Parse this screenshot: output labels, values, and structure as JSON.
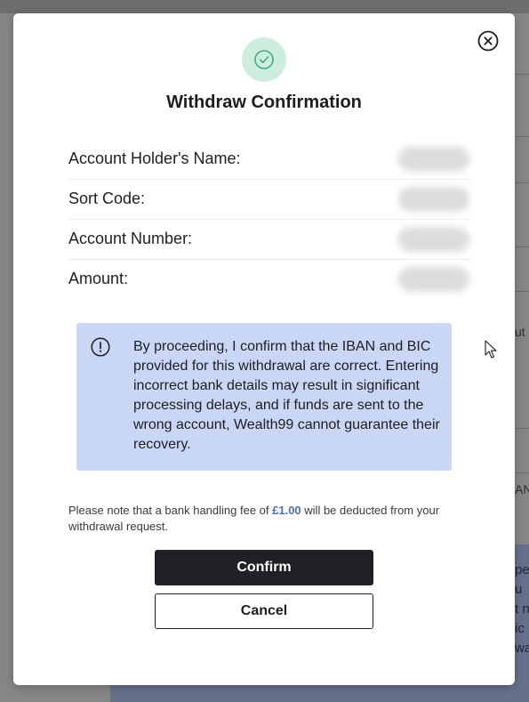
{
  "background": {
    "fragments": [
      "ut",
      "AN"
    ],
    "info_lines": [
      "pe",
      "u",
      "t n",
      "ic",
      "wa"
    ]
  },
  "modal": {
    "title": "Withdraw Confirmation",
    "close_icon": "close-circle-icon",
    "status_icon": "check-circle-icon",
    "details": [
      {
        "label": "Account Holder's Name:"
      },
      {
        "label": "Sort Code:"
      },
      {
        "label": "Account Number:"
      },
      {
        "label": "Amount:"
      }
    ],
    "notice": {
      "icon": "exclamation-circle-icon",
      "text": "By proceeding, I confirm that the IBAN and BIC provided for this withdrawal are correct. Entering incorrect bank details may result in significant processing delays, and if funds are sent to the wrong account, Wealth99 cannot guarantee their recovery."
    },
    "fee_note": {
      "before": "Please note that a bank handling fee of ",
      "amount": "£1.00",
      "after": " will be deducted from your withdrawal request."
    },
    "confirm_label": "Confirm",
    "cancel_label": "Cancel"
  },
  "colors": {
    "accent_fee": "#4a6fc2",
    "notice_bg": "#c9d7f5",
    "success_bg": "#cdeedf",
    "success_stroke": "#3daf77",
    "primary_button": "#202124"
  }
}
